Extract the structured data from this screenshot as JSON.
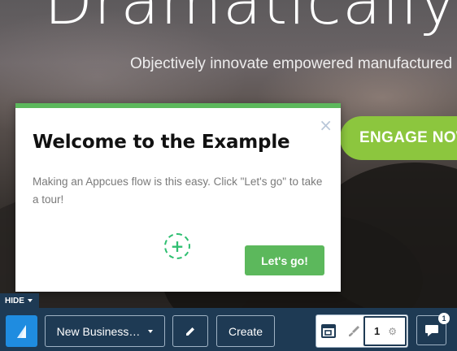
{
  "hero": {
    "title": "Dramatically",
    "subtitle": "Objectively innovate empowered manufactured pr",
    "cta_label": "ENGAGE NOW"
  },
  "modal": {
    "close_icon": "×",
    "title": "Welcome to the Example",
    "body": "Making an Appcues flow is this easy. Click \"Let's go\" to take a tour!",
    "add_icon": "+",
    "primary_button": "Let's go!",
    "accent_color": "#5cb85c"
  },
  "hide_tab": {
    "label": "HIDE"
  },
  "toolbar": {
    "flow_select_label": "New Business…",
    "create_label": "Create",
    "step_number": "1",
    "gear_icon": "⚙",
    "chat_badge": "1",
    "background_color": "#1e3a54",
    "logo_color": "#1f8ce0",
    "icons": [
      "appcues-logo-icon",
      "pencil-icon",
      "layout-icon",
      "brush-icon",
      "gear-icon",
      "chat-icon"
    ]
  }
}
